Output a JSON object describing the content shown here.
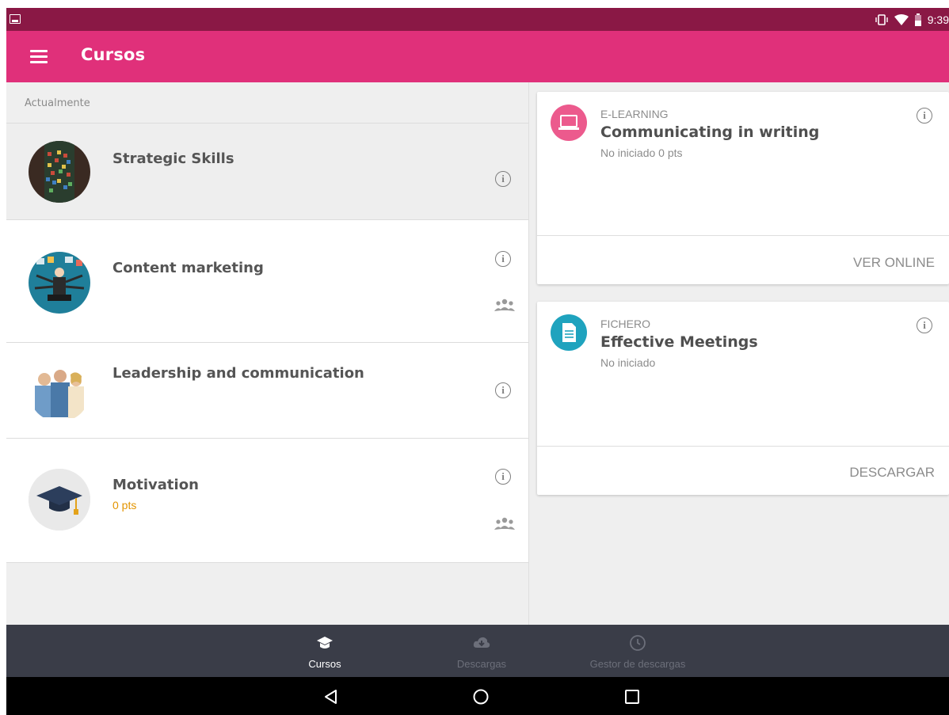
{
  "status_bar": {
    "time": "9:39"
  },
  "app_bar": {
    "title": "Cursos"
  },
  "left_panel": {
    "section_label": "Actualmente",
    "courses": [
      {
        "title": "Strategic Skills",
        "pts": ""
      },
      {
        "title": "Content marketing",
        "pts": ""
      },
      {
        "title": "Leadership and communication",
        "pts": ""
      },
      {
        "title": "Motivation",
        "pts": "0 pts"
      }
    ]
  },
  "cards": [
    {
      "type": "E-LEARNING",
      "title": "Communicating in writing",
      "status": "No iniciado  0 pts",
      "action": "VER ONLINE",
      "icon": "laptop-icon",
      "icon_color": "#ec5a8d"
    },
    {
      "type": "FICHERO",
      "title": "Effective Meetings",
      "status": "No iniciado",
      "action": "DESCARGAR",
      "icon": "document-icon",
      "icon_color": "#1fa3be"
    }
  ],
  "bottom_nav": {
    "items": [
      {
        "label": "Cursos",
        "icon": "graduation-cap-icon",
        "active": true
      },
      {
        "label": "Descargas",
        "icon": "cloud-download-icon",
        "active": false
      },
      {
        "label": "Gestor de descargas",
        "icon": "clock-icon",
        "active": false
      }
    ]
  },
  "colors": {
    "status_bar": "#8a1845",
    "app_bar": "#e0307a",
    "points": "#e39400",
    "bottom_nav": "#3a3d48"
  }
}
